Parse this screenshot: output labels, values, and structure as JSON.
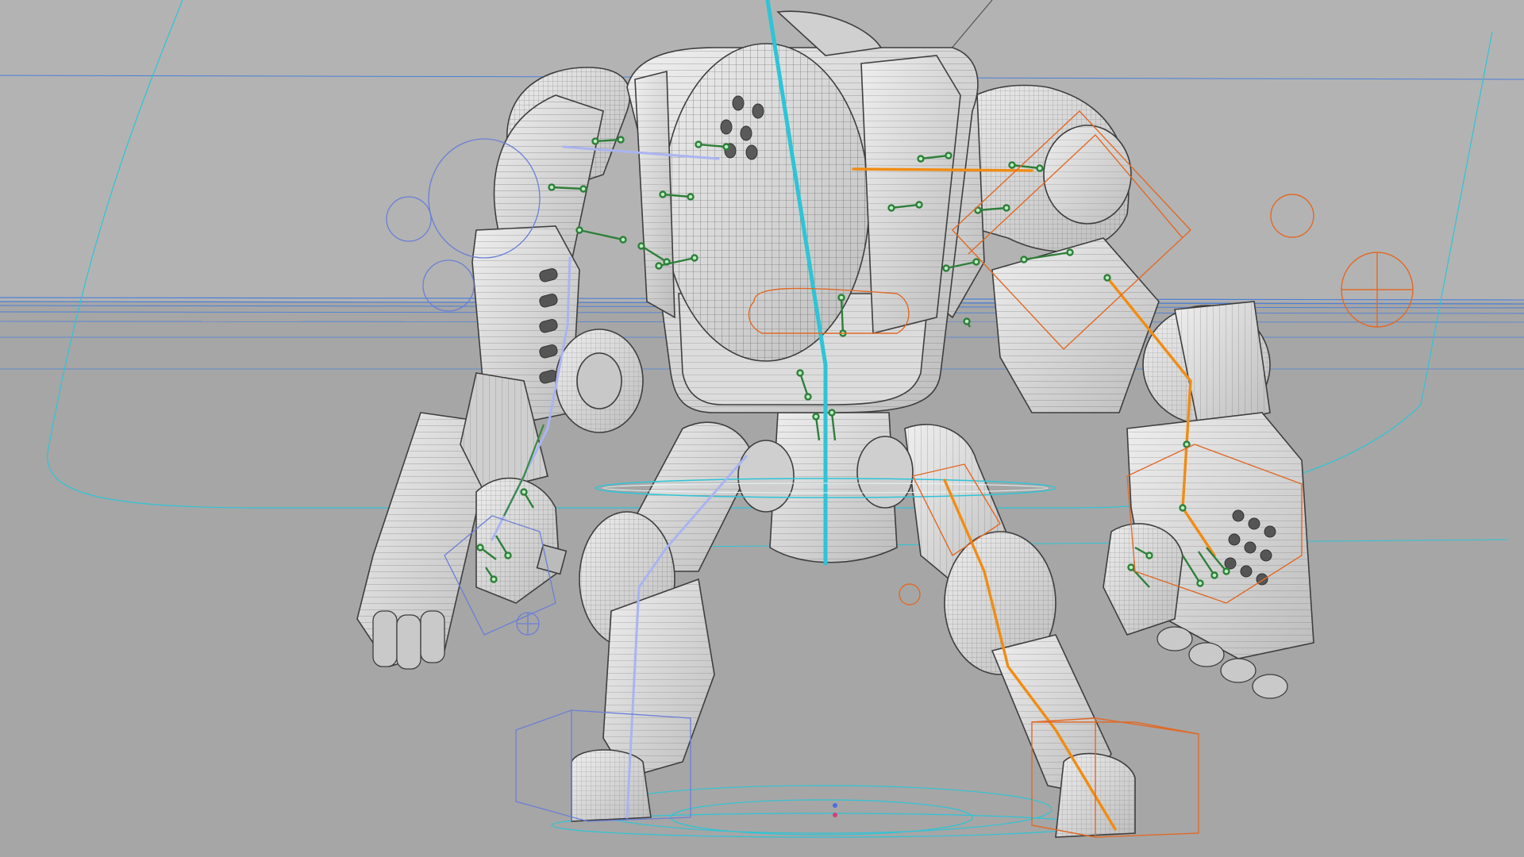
{
  "viewport": {
    "background_color": "#a9a9a9",
    "floor_color": "#a5a5a5",
    "wall_color": "#b3b3b3",
    "mesh_fill": "#d8d8d8",
    "mesh_line": "#4f4f4f"
  },
  "rig": {
    "spine_color": "#2ec4d6",
    "left_limb_color": "#aab4f0",
    "right_limb_color": "#f08c14",
    "right_control_color": "#e06a28",
    "left_control_color": "#6b7fd6",
    "pin_color": "#8fe0a0",
    "guide_color": "#4a7fd8"
  },
  "model": {
    "icon": "robot-mech-icon"
  }
}
